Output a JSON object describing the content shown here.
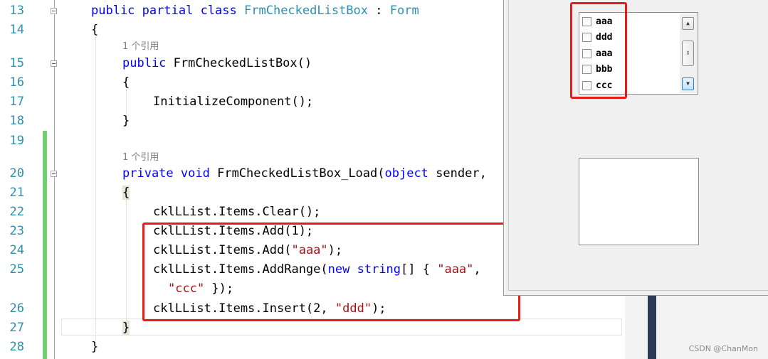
{
  "editor": {
    "line_numbers": [
      "13",
      "14",
      "15",
      "16",
      "17",
      "18",
      "19",
      "20",
      "21",
      "22",
      "23",
      "24",
      "25",
      "26",
      "27",
      "28"
    ],
    "ref_hint": "1 个引用",
    "code": {
      "l13": {
        "kw1": "public",
        "kw2": "partial",
        "kw3": "class",
        "name": "FrmCheckedListBox",
        "colon": " : ",
        "base": "Form"
      },
      "l14": "{",
      "l15": {
        "kw": "public",
        "rest": " FrmCheckedListBox()"
      },
      "l16": "{",
      "l17": "InitializeComponent();",
      "l18": "}",
      "l20": {
        "kw1": "private",
        "kw2": "void",
        "name": " FrmCheckedListBox_Load(",
        "kw3": "object",
        "rest": " sender,"
      },
      "l21": "{",
      "l22": "cklLList.Items.Clear();",
      "l23": "cklLList.Items.Add(1);",
      "l24": {
        "pre": "cklLList.Items.Add(",
        "str": "\"aaa\"",
        "post": ");"
      },
      "l25": {
        "pre": "cklLList.Items.AddRange(",
        "kw1": "new",
        "kw2": "string",
        "mid": "[] { ",
        "str": "\"aaa\"",
        "post": ","
      },
      "l25b": {
        "str": "\"ccc\"",
        "post": " });"
      },
      "l26": {
        "pre": "cklLList.Items.Insert(2, ",
        "str": "\"ddd\"",
        "post": ");"
      },
      "l27": "}",
      "l28": "}"
    }
  },
  "designer": {
    "checked_list_box": {
      "items": [
        {
          "label": "aaa",
          "checked": false
        },
        {
          "label": "ddd",
          "checked": false
        },
        {
          "label": "aaa",
          "checked": false
        },
        {
          "label": "bbb",
          "checked": false
        },
        {
          "label": "ccc",
          "checked": false
        }
      ]
    }
  },
  "colors": {
    "keyword": "#0000ff",
    "type": "#2b91af",
    "string": "#a31515",
    "line_number": "#2b91af",
    "change_bar": "#6fcf6f",
    "highlight_box": "#e81b1b"
  },
  "watermark": "CSDN @ChanMon"
}
